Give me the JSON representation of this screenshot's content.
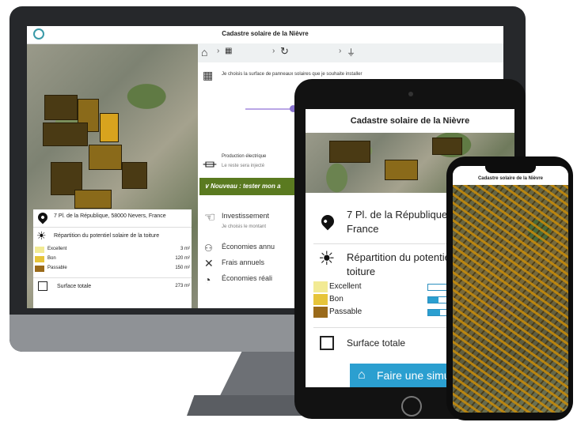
{
  "desktop": {
    "title": "Cadastre solaire de la Nièvre",
    "steps": [
      "",
      "",
      ""
    ],
    "panel_intro": "Je choisis la surface de panneaux solaires que je souhaite installer",
    "production_label": "Production électrique",
    "production_sub": "Le reste sera injecté",
    "new_label": "∨ Nouveau : tester mon a",
    "invest_label": "Investissement",
    "invest_sub": "Je choisis le montant",
    "eco_label": "Économies annu",
    "frais_label": "Frais annuels",
    "eco_real_label": "Économies réali",
    "address": "7 Pl. de la République, 58000 Nevers, France",
    "repartition": "Répartition du potentiel solaire de la toiture",
    "legend": [
      {
        "label": "Excellent",
        "value": "3 m²",
        "color": "#f2ea94"
      },
      {
        "label": "Bon",
        "value": "120 m²",
        "color": "#e6c43a"
      },
      {
        "label": "Passable",
        "value": "150 m²",
        "color": "#9a6a1a"
      }
    ],
    "surface_label": "Surface totale",
    "surface_value": "273 m²"
  },
  "tablet": {
    "title": "Cadastre solaire de la Nièvre",
    "address_line1": "7 Pl. de la République, 5",
    "address_line2": "France",
    "repartition_line1": "Répartition du potentie",
    "repartition_line2": "toiture",
    "legend": [
      {
        "label": "Excellent",
        "color": "#f2ea94",
        "fill": 0.0
      },
      {
        "label": "Bon",
        "color": "#e6c43a",
        "fill": 0.45
      },
      {
        "label": "Passable",
        "color": "#9a6a1a",
        "fill": 0.55
      }
    ],
    "surface_label": "Surface totale",
    "simulate_label": "Faire une simula",
    "accent": "#2b9fd0"
  },
  "phone": {
    "title": "Cadastre solaire de la Nièvre"
  }
}
